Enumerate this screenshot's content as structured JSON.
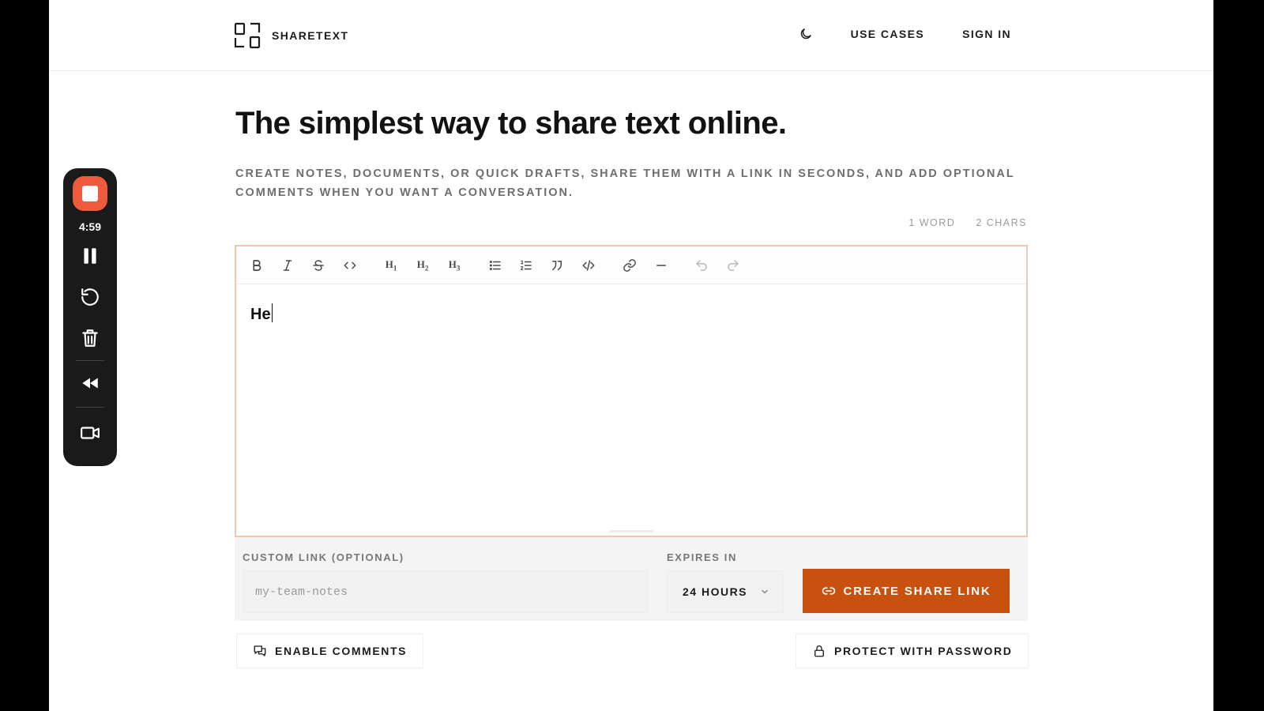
{
  "header": {
    "brand": "SHARETEXT",
    "nav": {
      "use_cases": "USE CASES",
      "sign_in": "SIGN IN"
    }
  },
  "hero": {
    "title": "The simplest way to share text online.",
    "subtitle": "CREATE NOTES, DOCUMENTS, OR QUICK DRAFTS, SHARE THEM WITH A LINK IN SECONDS, AND ADD OPTIONAL COMMENTS WHEN YOU WANT A CONVERSATION."
  },
  "counts": {
    "words": "1 WORD",
    "chars": "2 CHARS"
  },
  "editor": {
    "content": "He",
    "toolbar": [
      "bold-icon",
      "italic-icon",
      "strikethrough-icon",
      "inline-code-icon",
      "heading-1-icon",
      "heading-2-icon",
      "heading-3-icon",
      "bullet-list-icon",
      "ordered-list-icon",
      "blockquote-icon",
      "code-block-icon",
      "link-icon",
      "horizontal-rule-icon",
      "undo-icon",
      "redo-icon"
    ],
    "heading_labels": {
      "h1": "H",
      "h1_sub": "1",
      "h2": "H",
      "h2_sub": "2",
      "h3": "H",
      "h3_sub": "3"
    }
  },
  "options": {
    "custom_link_label": "CUSTOM LINK (OPTIONAL)",
    "custom_link_placeholder": "my-team-notes",
    "expires_label": "EXPIRES IN",
    "expires_value": "24 HOURS",
    "create_label": "CREATE SHARE LINK",
    "enable_comments": "ENABLE COMMENTS",
    "protect_password": "PROTECT WITH PASSWORD"
  },
  "recorder": {
    "time": "4:59"
  },
  "colors": {
    "accent": "#c8510f",
    "editor_border": "#f0c7ad",
    "record": "#f05a3c"
  }
}
